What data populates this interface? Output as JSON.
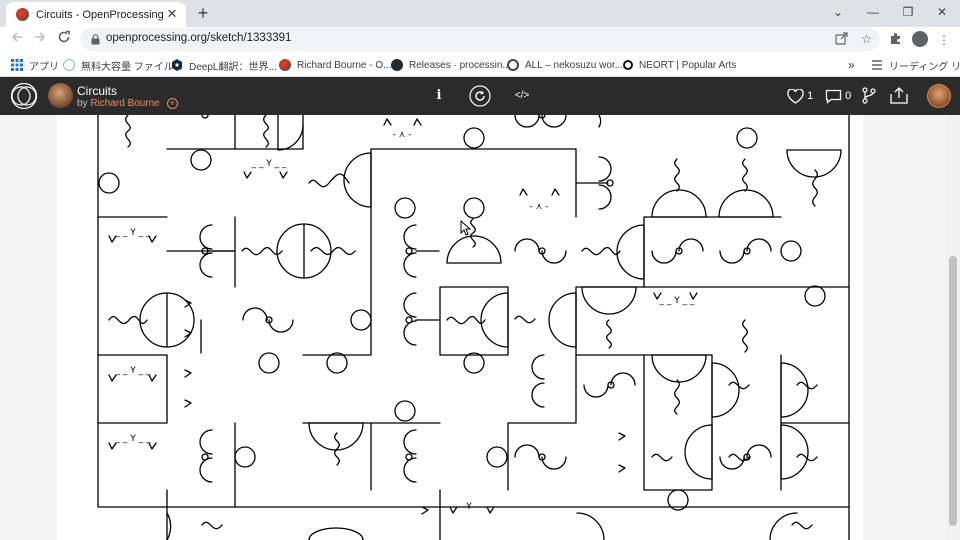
{
  "browser": {
    "tab": {
      "title": "Circuits - OpenProcessing",
      "close_glyph": "✕"
    },
    "new_tab_glyph": "+",
    "window_controls": {
      "collapse": "⌄",
      "minimize": "—",
      "restore": "❐",
      "close": "✕"
    },
    "url": "openprocessing.org/sketch/1333391",
    "bookmarks": [
      {
        "label": "アプリ",
        "icon": "apps-grid-icon",
        "color": "#1a73e8"
      },
      {
        "label": "無料大容量 ファイル...",
        "icon": "file-transfer-icon",
        "color": "#8ab4f8"
      },
      {
        "label": "DeepL翻訳：世界...",
        "icon": "deepl-icon",
        "color": "#0f2b46"
      },
      {
        "label": "Richard Bourne - O...",
        "icon": "openprocessing-icon",
        "color": "#c0392b"
      },
      {
        "label": "Releases · processin...",
        "icon": "github-icon",
        "color": "#24292e"
      },
      {
        "label": "ALL – nekosuzu wor...",
        "icon": "nekosuzu-icon",
        "color": "#444444"
      },
      {
        "label": "NEORT | Popular Arts",
        "icon": "neort-icon",
        "color": "#111111"
      }
    ],
    "bookmarks_overflow": "»",
    "reading_list": "リーディング リスト"
  },
  "sketch": {
    "title": "Circuits",
    "by_prefix": "by",
    "author": "Richard Bourne",
    "follow_glyph": "+",
    "info_glyph": "i",
    "code_glyph": "</>",
    "likes": "1",
    "comments": "0"
  },
  "colors": {
    "header_bg": "#2b2b2b",
    "author_accent": "#f08a5d",
    "tab_strip": "#dee1e6",
    "omnibox": "#f1f3f4"
  }
}
